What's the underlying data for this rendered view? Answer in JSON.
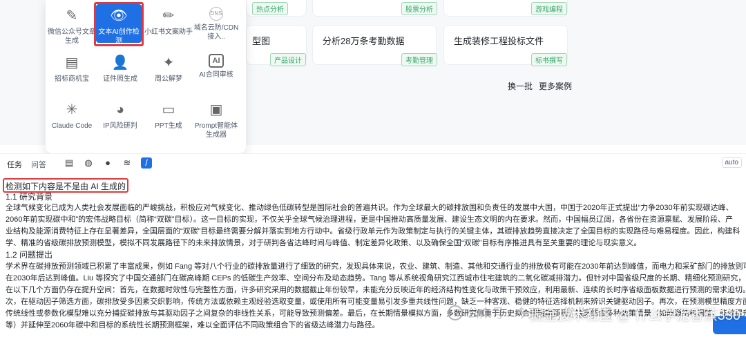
{
  "cards": [
    {
      "title": "",
      "tag": "热点分析",
      "tag_color": "green"
    },
    {
      "title": "",
      "tag": "股票分析",
      "tag_color": "green"
    },
    {
      "title": "",
      "tag": "游戏编程",
      "tag_color": "green"
    },
    {
      "title": "型图",
      "tag": "产品设计",
      "tag_color": "green"
    },
    {
      "title": "分析28万条考勤数据",
      "tag": "考勤管理",
      "tag_color": "green"
    },
    {
      "title": "生成装修工程投标文件",
      "tag": "标书撰写",
      "tag_color": "green"
    }
  ],
  "more": {
    "refresh": "换一批",
    "more_cases": "更多案例"
  },
  "tools": [
    {
      "label": "微信公众号文章生成",
      "icon": "✎"
    },
    {
      "label": "文本AI创作检测",
      "icon": "👁"
    },
    {
      "label": "小红书文案助手",
      "icon": "✏"
    },
    {
      "label": "域名云防/CDN接入..",
      "icon": "DNS"
    },
    {
      "label": "招标商机宝",
      "icon": "▤"
    },
    {
      "label": "证件照生成",
      "icon": "👤"
    },
    {
      "label": "周公解梦",
      "icon": "✦"
    },
    {
      "label": "AI合同审核",
      "icon": "AI"
    },
    {
      "label": "Claude Code",
      "icon": "✳"
    },
    {
      "label": "IP风险研判",
      "icon": "◕"
    },
    {
      "label": "PPT生成",
      "icon": "▭"
    },
    {
      "label": "Prompt智能体生成器",
      "icon": "▣"
    }
  ],
  "toolbar": {
    "task": "任务",
    "qa": "问答",
    "auto": "auto"
  },
  "prompt": "检测如下内容是不是由 AI 生成的：",
  "paragraphs": [
    "1.1 研究背景",
    "全球气候变化已成为人类社会发展面临的严峻挑战，积极应对气候变化、推动绿色低碳转型是国际社会的普遍共识。作为全球最大的碳排放国和负责任的发展中大国，中国于2020年正式提出“力争2030年前实现碳达峰、",
    "2060年前实现碳中和”的宏伟战略目标（简称“双碳”目标）。这一目标的实现，不仅关乎全球气候治理进程，更是中国推动高质量发展、建设生态文明的内在要求。然而，中国幅员辽阔，各省份在资源禀赋、发展阶段、产",
    "业结构及能源消费特征上存在显著差异，全国层面的“双碳”目标最终需要分解并落实到地方行动中。省级行政单元作为政策制定与执行的关键主体，其碳排放趋势直接决定了全国目标的实现路径与难易程度。因此，构建科",
    "学、精准的省级碳排放预测模型，模拟不同发展路径下的未来排放情景，对于研判各省达峰时间与峰值、制定差异化政策、以及确保全国“双碳”目标有序推进具有至关重要的理论与现实意义。",
    "1.2 问题提出",
    "学术界在碳排放预测领域已积累了丰富成果，例如 Fang 等对八个行业的碳排放量进行了细致的研究，发现具体来说，农业、建筑、制造、其他和交通行业的排放极有可能在2030年前达到峰值，而电力和采矿部门的排放则可能",
    "在2030年后达到峰值。Liu 等探究了中国交通部门在碳高峰期 CEPs 的低碳生产效率、空间分布及动态趋势。Tang 等从系统视角研究江西城市住宅建筑的二氧化碳减排潜力。但针对中国省级尺度的长期、精细化预测研究，尤其",
    "在以下几个方面仍存在提升空间：首先，在数据时效性与完整性方面，许多研究采用的数据截止年份较早，未能充分反映近年的经济结构性变化与政策干预效应，利用最新、连续的长时序省级面板数据进行预测的需求迫切。其",
    "次，在驱动因子筛选方面，碳排放受多因素交织影响，传统方法或依赖主观经验选取变量，或使用所有可能变量易引发多重共线性问题，缺乏一种客观、稳健的特征选择机制来辨识关键驱动因子。再次，在预测模型精度方面，",
    "传统线性或参数化模型难以充分捕捉碳排放与其驱动因子之间复杂的非线性关系，可能导致预测偏差。最后，在长期情景模拟方面，多数研究侧重于历史拟合或短期预测，缺乏结合多种政策情景（如能源结构调整、能效提升",
    "等）并延伸至2060年碳中和目标的系统性长期预测框架，难以全面评估不同政策组合下的省级达峰潜力与路径。"
  ],
  "watermark": "掘金技术社区 @ 什么学泥香蕉330",
  "watermark_faint": "公众号 · 今天aipy赏业了吗",
  "colors": {
    "accent": "#1f6fe5",
    "highlight": "#e0383e",
    "tag_green": "#3aa76d"
  }
}
